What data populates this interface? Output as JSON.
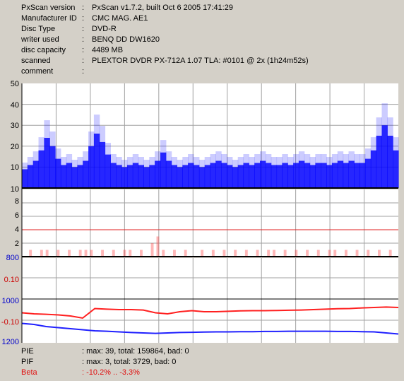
{
  "info": [
    {
      "key": "PxScan version",
      "value": "PxScan v1.7.2, built Oct  6 2005 17:41:29"
    },
    {
      "key": "Manufacturer ID",
      "value": "CMC MAG. AE1"
    },
    {
      "key": "Disc Type",
      "value": "DVD-R"
    },
    {
      "key": "writer used",
      "value": "BENQ DD DW1620"
    },
    {
      "key": "disc capacity",
      "value": "4489 MB"
    },
    {
      "key": "scanned",
      "value": "PLEXTOR DVDR PX-712A 1.07 TLA: #0101 @ 2x (1h24m52s)"
    },
    {
      "key": "comment",
      "value": ""
    }
  ],
  "separator": ":",
  "panels": {
    "pie": {
      "ticks": [
        "50",
        "40",
        "30",
        "20",
        "10"
      ],
      "bottom_label": "10",
      "ylim": [
        0,
        50
      ]
    },
    "pif": {
      "ticks": [
        "8",
        "6",
        "4",
        "2"
      ],
      "bottom_label": "800",
      "ylim": [
        0,
        10
      ],
      "limit_line": 4
    },
    "jitter": {
      "ticks": [
        "0.10",
        "1000",
        "-0.10",
        "1200"
      ],
      "ylim": [
        800,
        1200
      ]
    }
  },
  "colors": {
    "pie": "#0000ff",
    "pif": "#ff3030",
    "beta": "#ff2020",
    "jitter": "#2020ff",
    "grid": "#a0a0a0",
    "plot_bg": "#ffffff",
    "window_bg": "#d4d0c8"
  },
  "footer": [
    {
      "key": "PIE",
      "value": ": max: 39, total: 159864, bad: 0",
      "color": "#000000"
    },
    {
      "key": "PIF",
      "value": ": max: 3, total: 3729, bad: 0",
      "color": "#000000"
    },
    {
      "key": "Beta",
      "value": ": -10.2% .. -3.3%",
      "color": "#e01010"
    }
  ],
  "chart_data": [
    {
      "type": "area",
      "series": [
        {
          "name": "PIE",
          "values": [
            9,
            11,
            13,
            18,
            24,
            20,
            14,
            11,
            12,
            10,
            11,
            13,
            20,
            26,
            22,
            16,
            12,
            11,
            10,
            11,
            12,
            11,
            10,
            11,
            13,
            17,
            13,
            11,
            10,
            11,
            12,
            11,
            10,
            11,
            12,
            13,
            12,
            11,
            10,
            11,
            12,
            11,
            12,
            13,
            12,
            11,
            11,
            12,
            11,
            12,
            13,
            12,
            11,
            12,
            12,
            11,
            12,
            13,
            12,
            13,
            12,
            12,
            14,
            18,
            25,
            30,
            25,
            18
          ]
        }
      ],
      "ylim": [
        0,
        50
      ]
    },
    {
      "type": "bar",
      "series": [
        {
          "name": "PIF",
          "values": [
            0,
            1,
            0,
            1,
            1,
            0,
            1,
            0,
            1,
            0,
            1,
            1,
            1,
            0,
            1,
            0,
            1,
            0,
            1,
            1,
            0,
            1,
            0,
            2,
            3,
            1,
            0,
            1,
            0,
            1,
            0,
            0,
            1,
            0,
            1,
            0,
            1,
            0,
            1,
            0,
            1,
            0,
            1,
            0,
            1,
            1,
            0,
            1,
            0,
            1,
            0,
            1,
            0,
            1,
            0,
            1,
            1,
            0,
            1,
            0,
            1,
            0,
            1,
            0,
            1,
            0,
            1,
            0
          ]
        }
      ],
      "ylim": [
        0,
        10
      ]
    },
    {
      "type": "line",
      "series": [
        {
          "name": "Beta",
          "values": [
            -0.065,
            -0.07,
            -0.072,
            -0.075,
            -0.08,
            -0.09,
            -0.045,
            -0.048,
            -0.05,
            -0.05,
            -0.052,
            -0.065,
            -0.07,
            -0.06,
            -0.055,
            -0.06,
            -0.06,
            -0.058,
            -0.056,
            -0.055,
            -0.055,
            -0.054,
            -0.053,
            -0.052,
            -0.05,
            -0.048,
            -0.046,
            -0.045,
            -0.042,
            -0.04,
            -0.038,
            -0.04
          ]
        },
        {
          "name": "Jitter",
          "values": [
            -0.115,
            -0.12,
            -0.13,
            -0.135,
            -0.14,
            -0.145,
            -0.15,
            -0.152,
            -0.155,
            -0.158,
            -0.16,
            -0.162,
            -0.16,
            -0.158,
            -0.157,
            -0.156,
            -0.155,
            -0.155,
            -0.154,
            -0.154,
            -0.153,
            -0.153,
            -0.152,
            -0.152,
            -0.152,
            -0.152,
            -0.153,
            -0.153,
            -0.154,
            -0.155,
            -0.16,
            -0.165
          ]
        }
      ]
    }
  ]
}
